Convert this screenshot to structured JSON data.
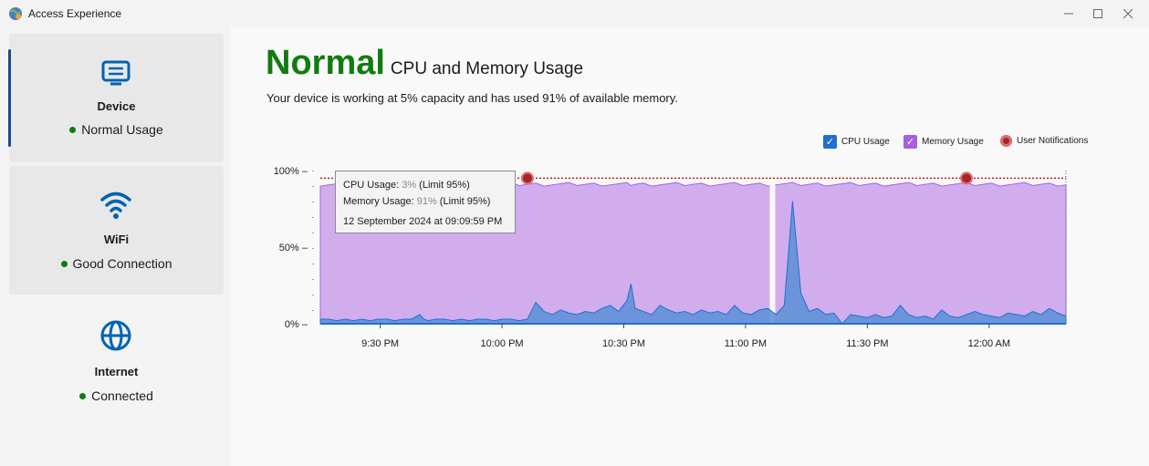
{
  "window": {
    "title": "Access Experience"
  },
  "sidebar": {
    "items": [
      {
        "label": "Device",
        "status": "Normal Usage",
        "icon": "monitor-icon"
      },
      {
        "label": "WiFi",
        "status": "Good Connection",
        "icon": "wifi-icon"
      },
      {
        "label": "Internet",
        "status": "Connected",
        "icon": "globe-icon"
      }
    ]
  },
  "main": {
    "status_word": "Normal",
    "heading": "CPU and Memory Usage",
    "subtitle": "Your device is working at 5% capacity and has used 91% of available memory."
  },
  "legend": {
    "cpu": "CPU Usage",
    "memory": "Memory Usage",
    "notifications": "User Notifications"
  },
  "tooltip": {
    "cpu_label": "CPU Usage:",
    "cpu_value": "3%",
    "cpu_limit": "(Limit 95%)",
    "mem_label": "Memory Usage:",
    "mem_value": "91%",
    "mem_limit": "(Limit 95%)",
    "timestamp": "12 September 2024 at 09:09:59 PM"
  },
  "colors": {
    "status_green": "#107c10",
    "cpu_blue": "#1f6fd0",
    "memory_purple": "#a461e0",
    "memory_fill": "#d2adee",
    "notification_red": "#a4262c"
  },
  "chart_data": {
    "type": "area",
    "ylim": [
      0,
      100
    ],
    "yticks": [
      "100%",
      "50%",
      "0%"
    ],
    "xticks": [
      "9:30 PM",
      "10:00 PM",
      "10:30 PM",
      "11:00 PM",
      "11:30 PM",
      "12:00 AM"
    ],
    "limit": 95,
    "series": [
      {
        "name": "CPU Usage",
        "x": [
          0,
          4,
          8,
          12,
          16,
          20,
          24,
          28,
          32,
          36,
          40,
          44,
          48,
          50,
          52,
          56,
          60,
          64,
          68,
          72,
          76,
          80,
          84,
          88,
          92,
          96,
          100,
          104,
          108,
          112,
          116,
          120,
          124,
          128,
          132,
          136,
          140,
          144,
          148,
          150,
          152,
          156,
          160,
          164,
          168,
          172,
          176,
          180,
          184,
          188,
          192,
          196,
          200,
          204,
          208,
          212,
          216,
          220,
          224,
          228,
          232,
          236,
          240,
          244,
          248,
          252,
          256,
          260,
          264,
          268,
          272,
          276,
          280,
          284,
          288,
          292,
          296,
          300,
          304,
          308,
          312,
          316,
          320,
          324,
          328,
          332,
          336,
          340,
          344,
          348,
          352,
          356,
          360
        ],
        "values": [
          3,
          3,
          2,
          3,
          2,
          3,
          2,
          3,
          3,
          2,
          3,
          3,
          6,
          3,
          2,
          3,
          3,
          2,
          3,
          2,
          3,
          3,
          2,
          3,
          3,
          2,
          3,
          14,
          8,
          6,
          9,
          7,
          6,
          8,
          7,
          10,
          12,
          8,
          15,
          26,
          10,
          8,
          6,
          12,
          9,
          7,
          8,
          6,
          9,
          7,
          8,
          6,
          12,
          7,
          6,
          9,
          10,
          6,
          12,
          80,
          20,
          8,
          10,
          6,
          7,
          0,
          6,
          5,
          4,
          6,
          4,
          5,
          12,
          6,
          4,
          5,
          3,
          9,
          5,
          4,
          6,
          8,
          6,
          5,
          4,
          7,
          6,
          5,
          8,
          6,
          10,
          7,
          5
        ],
        "x_unit": "minutes since 9:05 PM"
      },
      {
        "name": "Memory Usage",
        "values_approx": 91
      }
    ],
    "notifications": [
      {
        "x_label": "about 10:05 PM",
        "value": 95
      },
      {
        "x_label": "about 11:42 PM",
        "value": 95
      }
    ]
  }
}
